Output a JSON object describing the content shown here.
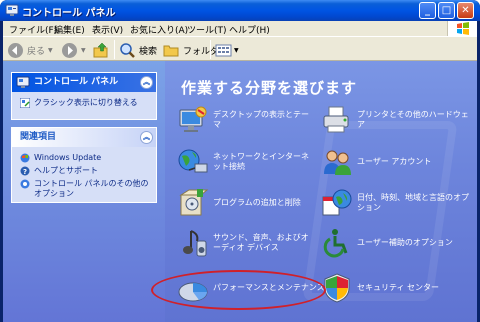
{
  "window": {
    "title": "コントロール パネル",
    "controls": {
      "minimize": "_",
      "maximize": "□",
      "close": "✕"
    }
  },
  "menubar": {
    "items": [
      "ファイル(F)",
      "編集(E)",
      "表示(V)",
      "お気に入り(A)",
      "ツール(T)",
      "ヘルプ(H)"
    ]
  },
  "toolbar": {
    "back": "戻る",
    "search": "検索",
    "folders": "フォルダ"
  },
  "sidebar": {
    "control_panel": {
      "title": "コントロール パネル",
      "links": [
        "クラシック表示に切り替える"
      ]
    },
    "related": {
      "title": "関連項目",
      "links": [
        "Windows Update",
        "ヘルプとサポート",
        "コントロール パネルのその他のオプション"
      ]
    }
  },
  "main": {
    "heading": "作業する分野を選びます",
    "categories": [
      {
        "label": "デスクトップの表示とテーマ",
        "icon": "desktop-icon"
      },
      {
        "label": "プリンタとその他のハードウェア",
        "icon": "printer-icon"
      },
      {
        "label": "ネットワークとインターネット接続",
        "icon": "network-icon"
      },
      {
        "label": "ユーザー アカウント",
        "icon": "users-icon"
      },
      {
        "label": "プログラムの追加と削除",
        "icon": "programs-icon"
      },
      {
        "label": "日付、時刻、地域と言語のオプション",
        "icon": "datetime-icon"
      },
      {
        "label": "サウンド、音声、およびオーディオ デバイス",
        "icon": "sound-icon"
      },
      {
        "label": "ユーザー補助のオプション",
        "icon": "accessibility-icon"
      },
      {
        "label": "パフォーマンスとメンテナンス",
        "icon": "performance-icon"
      },
      {
        "label": "セキュリティ センター",
        "icon": "security-shield-icon"
      }
    ]
  },
  "colors": {
    "titlebar": "#0054e3",
    "sidebar": "#7ba2e7",
    "main_bg": "#6d85dc",
    "highlight": "#d0202a"
  }
}
